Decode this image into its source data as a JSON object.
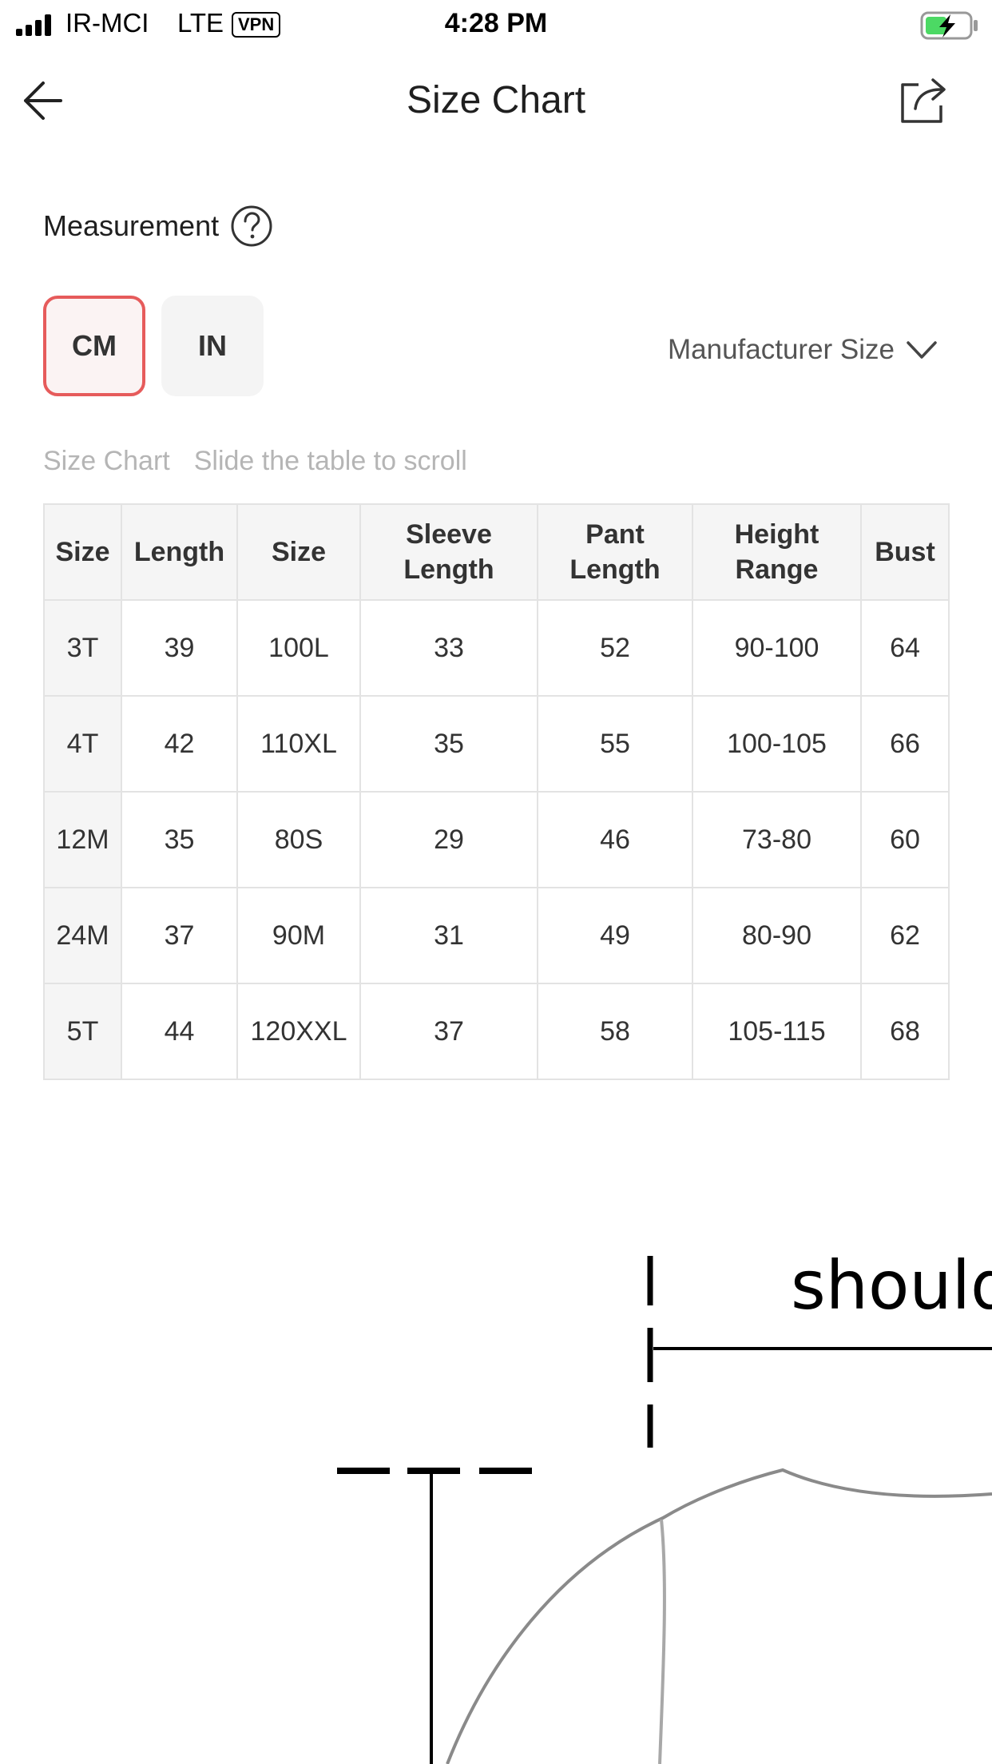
{
  "status_bar": {
    "carrier": "IR-MCI",
    "network": "LTE",
    "vpn": "VPN",
    "time": "4:28 PM"
  },
  "nav": {
    "title": "Size Chart",
    "back_icon": "arrow-left-icon",
    "share_icon": "share-icon"
  },
  "measurement": {
    "label": "Measurement",
    "help_icon": "question-circle-icon",
    "units": [
      {
        "label": "CM",
        "selected": true
      },
      {
        "label": "IN",
        "selected": false
      }
    ],
    "size_type": {
      "label": "Manufacturer Size",
      "icon": "chevron-down-icon"
    }
  },
  "hint": {
    "title": "Size Chart",
    "instruction": "Slide the table to scroll"
  },
  "table": {
    "headers": [
      [
        "Size"
      ],
      [
        "Length"
      ],
      [
        "Size"
      ],
      [
        "Sleeve",
        "Length"
      ],
      [
        "Pant",
        "Length"
      ],
      [
        "Height",
        "Range"
      ],
      [
        "Bust"
      ]
    ],
    "rows": [
      [
        "3T",
        "39",
        "100L",
        "33",
        "52",
        "90-100",
        "64"
      ],
      [
        "4T",
        "42",
        "110XL",
        "35",
        "55",
        "100-105",
        "66"
      ],
      [
        "12M",
        "35",
        "80S",
        "29",
        "46",
        "73-80",
        "60"
      ],
      [
        "24M",
        "37",
        "90M",
        "31",
        "49",
        "80-90",
        "62"
      ],
      [
        "5T",
        "44",
        "120XXL",
        "37",
        "58",
        "105-115",
        "68"
      ]
    ]
  },
  "diagram": {
    "label": "should"
  },
  "colors": {
    "accent": "#e65b5b",
    "battery": "#4cd964",
    "table_border": "#e3e3e3",
    "hint": "#b5b5b5"
  }
}
